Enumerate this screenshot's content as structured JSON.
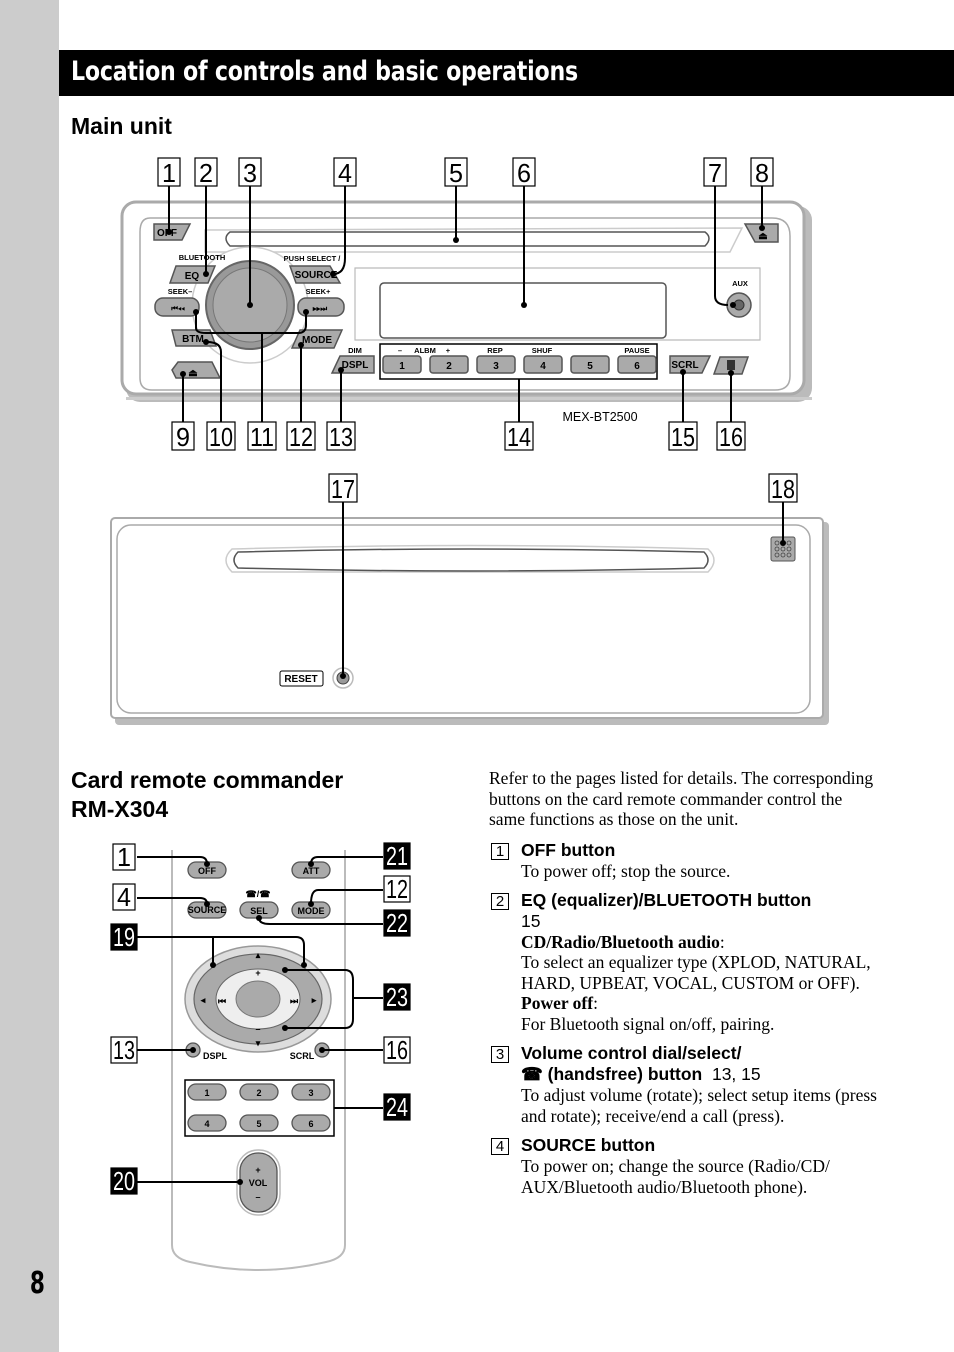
{
  "page": {
    "number": "8",
    "title": "Location of controls and basic operations"
  },
  "main_unit": {
    "heading": "Main unit",
    "model": "MEX-BT2500",
    "callouts_top": [
      "1",
      "2",
      "3",
      "4",
      "5",
      "6",
      "7",
      "8"
    ],
    "callouts_bottom": [
      "9",
      "10",
      "11",
      "12",
      "13",
      "14",
      "15",
      "16"
    ],
    "callouts_panel": [
      "17",
      "18"
    ],
    "buttons": {
      "off": "OFF",
      "bluetooth_label": "BLUETOOTH",
      "eq": "EQ",
      "push_select": "PUSH SELECT /",
      "source": "SOURCE",
      "seek_minus": "SEEK–",
      "seek_plus": "SEEK+",
      "prev_glyph": "⏮◂◂",
      "next_glyph": "▸▸⏭",
      "btm": "BTM",
      "mode": "MODE",
      "dim": "DIM",
      "dspl": "DSPL",
      "minus": "–",
      "albm": "ALBM",
      "plus": "+",
      "rep": "REP",
      "shuf": "SHUF",
      "pause": "PAUSE",
      "presets": [
        "1",
        "2",
        "3",
        "4",
        "5",
        "6"
      ],
      "scrl": "SCRL",
      "aux": "AUX",
      "reset": "RESET",
      "eject_glyph": "⏏"
    }
  },
  "remote": {
    "heading_line1": "Card remote commander",
    "heading_line2": "RM-X304",
    "callouts_left": [
      "1",
      "4",
      "19",
      "13",
      "20"
    ],
    "callouts_right": [
      "21",
      "12",
      "22",
      "23",
      "16",
      "24"
    ],
    "buttons": {
      "off": "OFF",
      "att": "ATT",
      "source": "SOURCE",
      "sel": "SEL",
      "mode": "MODE",
      "plus": "+",
      "minus": "–",
      "prev": "⏮",
      "next": "⏭",
      "dspl": "DSPL",
      "scrl": "SCRL",
      "numbers": [
        "1",
        "2",
        "3",
        "4",
        "5",
        "6"
      ],
      "vol": "VOL",
      "vol_plus": "+",
      "vol_minus": "–"
    }
  },
  "description": {
    "intro": "Refer to the pages listed for details. The corresponding buttons on the card remote commander control the same functions as those on the unit.",
    "items": [
      {
        "num": "1",
        "title": "OFF button",
        "body": "To power off; stop the source."
      },
      {
        "num": "2",
        "title": "EQ (equalizer)/BLUETOOTH button",
        "pages": "15",
        "sub1_label": "CD/Radio/Bluetooth audio",
        "sub1_body": "To select an equalizer type (XPLOD, NATURAL, HARD, UPBEAT, VOCAL, CUSTOM or OFF).",
        "sub2_label": "Power off",
        "sub2_body": "For Bluetooth signal on/off, pairing."
      },
      {
        "num": "3",
        "title_line1": "Volume control dial/select/",
        "title_line2": "☎ (handsfree) button",
        "pages": "13, 15",
        "body": "To adjust volume (rotate); select setup items (press and rotate); receive/end a call (press)."
      },
      {
        "num": "4",
        "title": "SOURCE button",
        "body": "To power on; change the source (Radio/CD/ AUX/Bluetooth audio/Bluetooth phone)."
      }
    ]
  }
}
